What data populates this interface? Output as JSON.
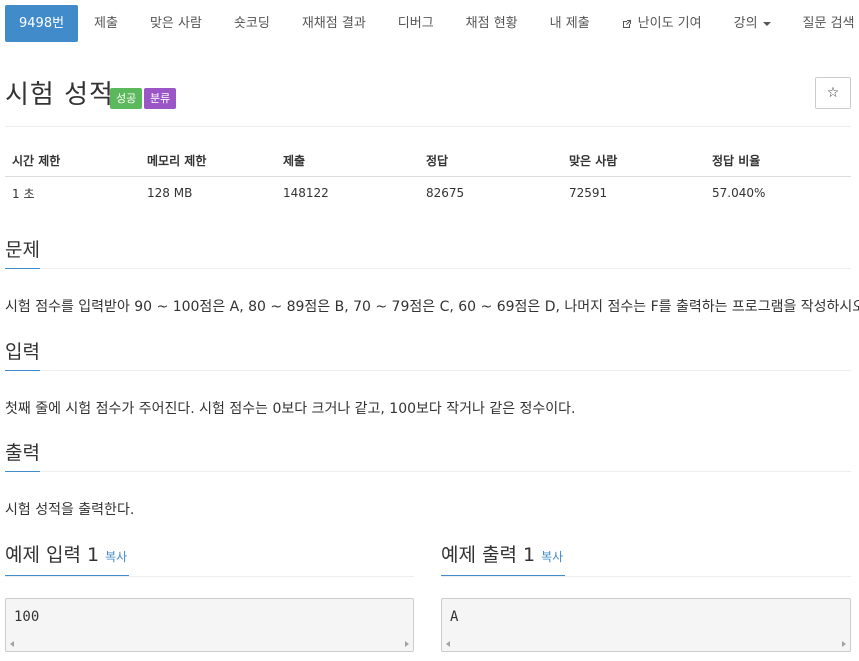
{
  "nav": {
    "tabs": [
      {
        "label": "9498번",
        "active": true
      },
      {
        "label": "제출"
      },
      {
        "label": "맞은 사람"
      },
      {
        "label": "숏코딩"
      },
      {
        "label": "재채점 결과"
      },
      {
        "label": "디버그"
      },
      {
        "label": "채점 현황"
      },
      {
        "label": "내 제출"
      },
      {
        "label": "난이도 기여",
        "icon": "external-link-icon"
      },
      {
        "label": "강의",
        "dropdown": true
      },
      {
        "label": "질문 검색"
      }
    ]
  },
  "problem": {
    "title": "시험 성적",
    "badges": {
      "success": "성공",
      "category": "분류"
    },
    "star_icon": "☆"
  },
  "info_table": {
    "headers": [
      "시간 제한",
      "메모리 제한",
      "제출",
      "정답",
      "맞은 사람",
      "정답 비율"
    ],
    "row": [
      "1 초",
      "128 MB",
      "148122",
      "82675",
      "72591",
      "57.040%"
    ]
  },
  "sections": {
    "problem_heading": "문제",
    "problem_text": "시험 점수를 입력받아 90 ~ 100점은 A, 80 ~ 89점은 B, 70 ~ 79점은 C, 60 ~ 69점은 D, 나머지 점수는 F를 출력하는 프로그램을 작성하시오.",
    "input_heading": "입력",
    "input_text": "첫째 줄에 시험 점수가 주어진다. 시험 점수는 0보다 크거나 같고, 100보다 작거나 같은 정수이다.",
    "output_heading": "출력",
    "output_text": "시험 성적을 출력한다."
  },
  "examples": {
    "input_heading": "예제 입력 1",
    "output_heading": "예제 출력 1",
    "copy_label": "복사",
    "input_value": "100",
    "output_value": "A"
  },
  "colors": {
    "primary": "#428bca",
    "success": "#5cb85c",
    "category": "#9a55c6"
  }
}
